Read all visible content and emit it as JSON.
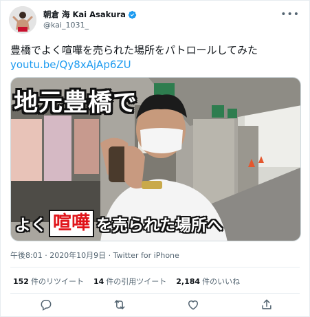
{
  "user": {
    "display_name": "朝倉 海 Kai Asakura",
    "handle": "@kai_1031_",
    "verified_icon": "verified-badge-icon",
    "more_label": "•••"
  },
  "tweet": {
    "text": "豊橋でよく喧嘩を売られた場所をパトロールしてみた",
    "link": "youtu.be/Qy8xAjAp6ZU",
    "timestamp": "午後8:01 · 2020年10月9日 · Twitter for iPhone"
  },
  "media": {
    "caption_top": "地元豊橋で",
    "caption_bottom_1": "よく",
    "caption_bottom_2": "喧嘩",
    "caption_bottom_3": "を売られた場所へ",
    "caption_color": "#e0141a"
  },
  "stats": {
    "retweets_count": "152",
    "retweets_label": "件のリツイート",
    "quotes_count": "14",
    "quotes_label": "件の引用ツイート",
    "likes_count": "2,184",
    "likes_label": "件のいいね"
  },
  "actions": {
    "reply_icon": "reply-icon",
    "retweet_icon": "retweet-icon",
    "like_icon": "heart-icon",
    "share_icon": "share-icon"
  },
  "colors": {
    "link": "#1d9bf0",
    "secondary_text": "#536471",
    "primary_text": "#0f1419",
    "verified": "#1d9bf0"
  }
}
